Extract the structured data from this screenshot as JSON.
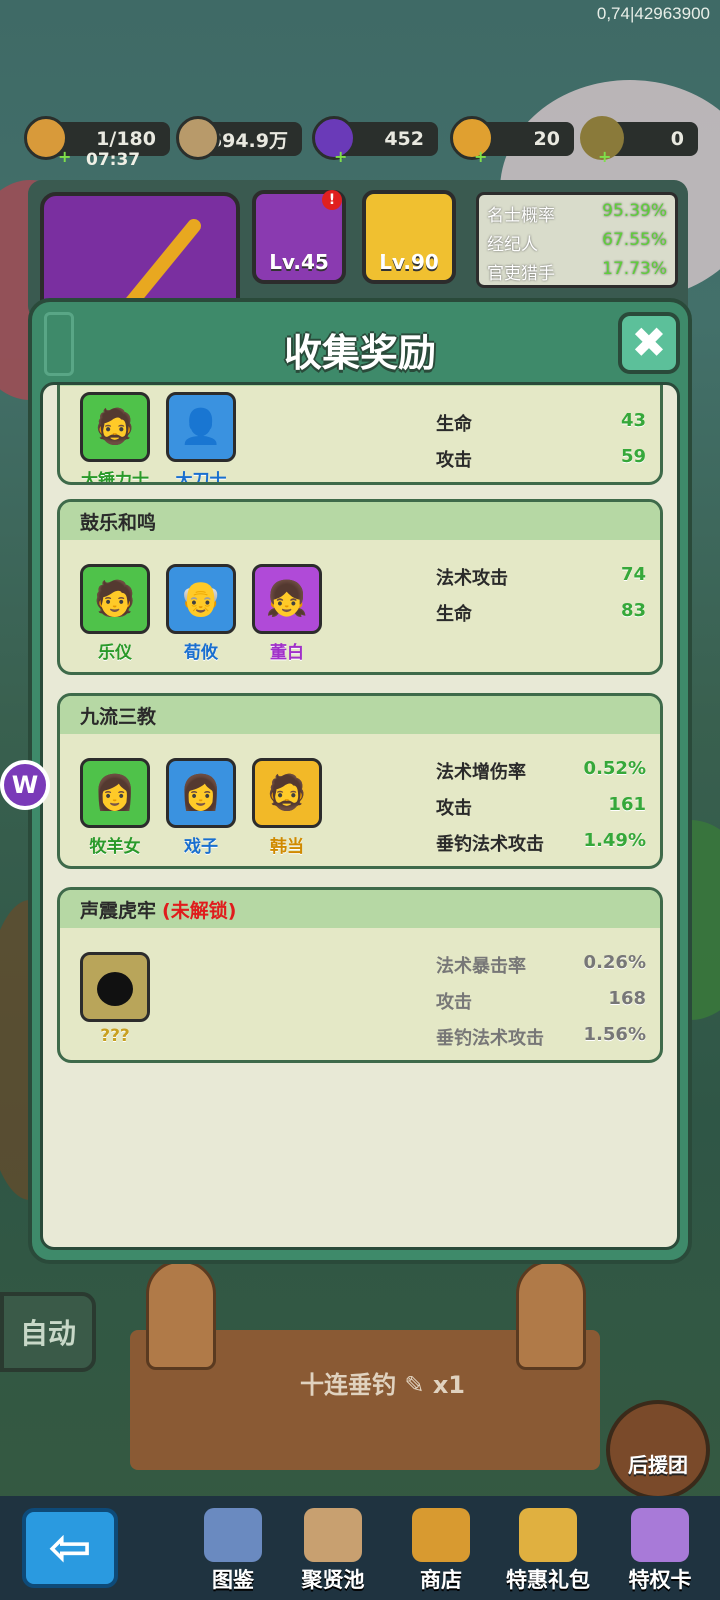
{
  "status": {
    "coords": "0,74|42963900"
  },
  "resources": {
    "stamina": "1/180",
    "timer": "07:37",
    "coins": "694.9万",
    "gems": "452",
    "tokens": "20",
    "rods": "0"
  },
  "equipment": {
    "slot1_level": "Lv.45",
    "slot2_level": "Lv.90"
  },
  "top_stats": [
    {
      "label": "名士概率",
      "value": "95.39%"
    },
    {
      "label": "经纪人",
      "value": "67.55%"
    },
    {
      "label": "官吏猎手",
      "value": "17.73%"
    }
  ],
  "modal": {
    "title": "收集奖励",
    "close_icon": "close-icon",
    "groups": [
      {
        "title": "",
        "heroes": [
          {
            "name": "大锤力士",
            "color": "green"
          },
          {
            "name": "大刀士",
            "color": "blue"
          }
        ],
        "stats": [
          {
            "label": "生命",
            "value": "43"
          },
          {
            "label": "攻击",
            "value": "59"
          }
        ]
      },
      {
        "title": "鼓乐和鸣",
        "heroes": [
          {
            "name": "乐仪",
            "color": "green"
          },
          {
            "name": "荀攸",
            "color": "blue"
          },
          {
            "name": "董白",
            "color": "purple"
          }
        ],
        "stats": [
          {
            "label": "法术攻击",
            "value": "74"
          },
          {
            "label": "生命",
            "value": "83"
          }
        ]
      },
      {
        "title": "九流三教",
        "heroes": [
          {
            "name": "牧羊女",
            "color": "green"
          },
          {
            "name": "戏子",
            "color": "blue"
          },
          {
            "name": "韩当",
            "color": "gold"
          }
        ],
        "stats": [
          {
            "label": "法术增伤率",
            "value": "0.52%"
          },
          {
            "label": "攻击",
            "value": "161"
          },
          {
            "label": "垂钓法术攻击",
            "value": "1.49%"
          }
        ]
      },
      {
        "title": "声震虎牢",
        "lock_text": "(未解锁)",
        "heroes": [
          {
            "name": "???",
            "color": "locked"
          }
        ],
        "stats": [
          {
            "label": "法术暴击率",
            "value": "0.26%"
          },
          {
            "label": "攻击",
            "value": "168"
          },
          {
            "label": "垂钓法术攻击",
            "value": "1.56%"
          }
        ]
      }
    ]
  },
  "bottom": {
    "auto_label": "自动",
    "ten_cast_label": "十连垂钓",
    "ten_cast_count": "x1",
    "helper_label": "后援团",
    "badge_letter": "W",
    "tabs": [
      {
        "label": "图鉴"
      },
      {
        "label": "聚贤池"
      },
      {
        "label": "商店"
      },
      {
        "label": "特惠礼包"
      },
      {
        "label": "特权卡"
      }
    ]
  }
}
